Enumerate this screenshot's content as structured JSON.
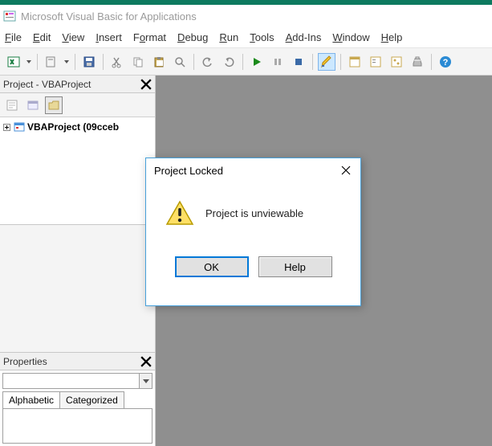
{
  "app": {
    "title": "Microsoft Visual Basic for Applications"
  },
  "menu": {
    "file": "File",
    "edit": "Edit",
    "view": "View",
    "insert": "Insert",
    "format": "Format",
    "debug": "Debug",
    "run": "Run",
    "tools": "Tools",
    "addins": "Add-Ins",
    "window": "Window",
    "help": "Help"
  },
  "project_explorer": {
    "title": "Project - VBAProject",
    "root_label": "VBAProject (09cceb"
  },
  "properties": {
    "title": "Properties",
    "tab_alpha": "Alphabetic",
    "tab_cat": "Categorized"
  },
  "dialog": {
    "title": "Project Locked",
    "message": "Project is unviewable",
    "ok": "OK",
    "help": "Help"
  }
}
